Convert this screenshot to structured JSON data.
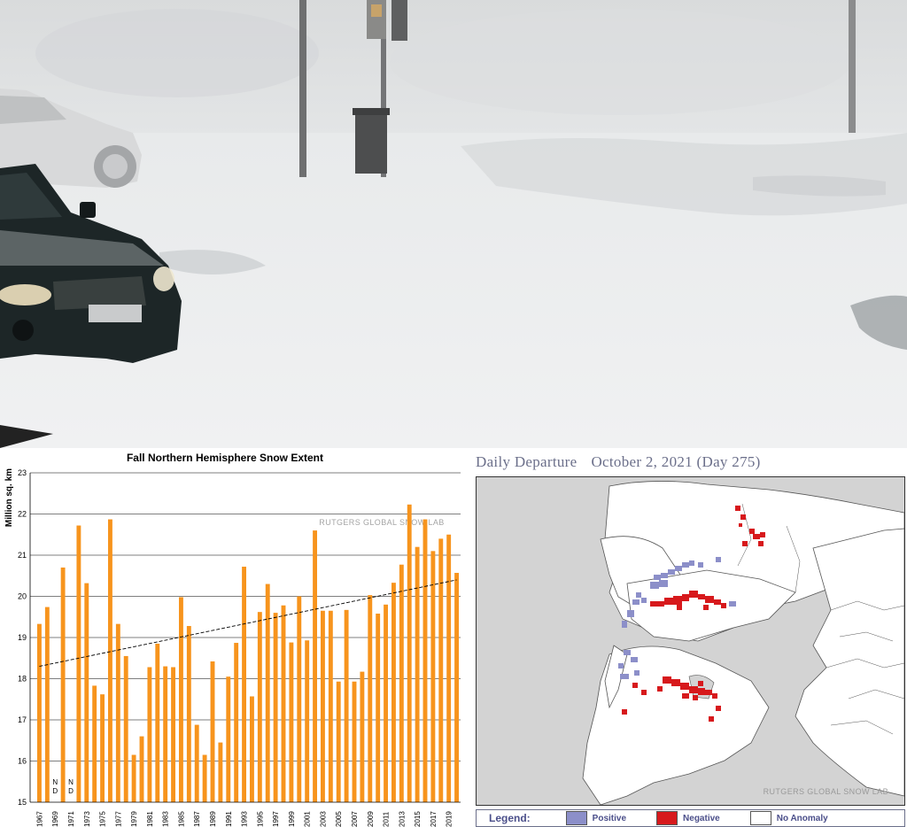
{
  "photo": {
    "description_icon": "snowy-street-photo"
  },
  "chart_data": {
    "type": "bar",
    "title": "Fall Northern Hemisphere Snow Extent",
    "ylabel": "Million sq. km",
    "watermark": "RUTGERS GLOBAL SNOW LAB",
    "ylim": [
      15,
      23
    ],
    "yticks": [
      15,
      16,
      17,
      18,
      19,
      20,
      21,
      22,
      23
    ],
    "categories": [
      "1967",
      "1968",
      "1969",
      "1970",
      "1971",
      "1972",
      "1973",
      "1974",
      "1975",
      "1976",
      "1977",
      "1978",
      "1979",
      "1980",
      "1981",
      "1982",
      "1983",
      "1984",
      "1985",
      "1986",
      "1987",
      "1988",
      "1989",
      "1990",
      "1991",
      "1992",
      "1993",
      "1994",
      "1995",
      "1996",
      "1997",
      "1998",
      "1999",
      "2000",
      "2001",
      "2002",
      "2003",
      "2004",
      "2005",
      "2006",
      "2007",
      "2008",
      "2009",
      "2010",
      "2011",
      "2012",
      "2013",
      "2014",
      "2015",
      "2016",
      "2017",
      "2018",
      "2019",
      "2020"
    ],
    "xtick_labels": [
      "1967",
      "1969",
      "1971",
      "1973",
      "1975",
      "1977",
      "1979",
      "1981",
      "1983",
      "1985",
      "1987",
      "1989",
      "1991",
      "1993",
      "1995",
      "1997",
      "1999",
      "2001",
      "2003",
      "2005",
      "2007",
      "2009",
      "2011",
      "2013",
      "2015",
      "2017",
      "2019"
    ],
    "values": [
      19.33,
      19.74,
      null,
      20.7,
      null,
      21.72,
      20.32,
      17.83,
      17.62,
      21.87,
      19.33,
      18.55,
      16.15,
      16.6,
      18.28,
      18.85,
      18.3,
      18.28,
      19.98,
      19.28,
      16.88,
      16.15,
      18.42,
      16.45,
      18.05,
      18.87,
      20.72,
      17.57,
      19.62,
      20.3,
      19.6,
      19.78,
      18.88,
      20.0,
      18.93,
      21.6,
      19.65,
      19.65,
      17.93,
      19.67,
      17.93,
      18.17,
      20.03,
      19.58,
      19.8,
      20.33,
      20.77,
      22.23,
      21.2,
      21.87,
      21.1,
      21.4,
      21.5,
      20.57
    ],
    "nd_label": [
      "N",
      "D"
    ],
    "bar_color": "#f7941d",
    "trend": {
      "start": 18.3,
      "end": 20.4
    }
  },
  "map": {
    "title_left": "Daily Departure",
    "title_right": "October 2, 2021 (Day 275)",
    "credit": "RUTGERS GLOBAL SNOW LAB",
    "legend": {
      "title": "Legend:",
      "items": [
        {
          "label": "Positive",
          "color": "#8c8fc9"
        },
        {
          "label": "Negative",
          "color": "#d7191c"
        },
        {
          "label": "No Anomaly",
          "color": "#ffffff"
        }
      ]
    }
  }
}
